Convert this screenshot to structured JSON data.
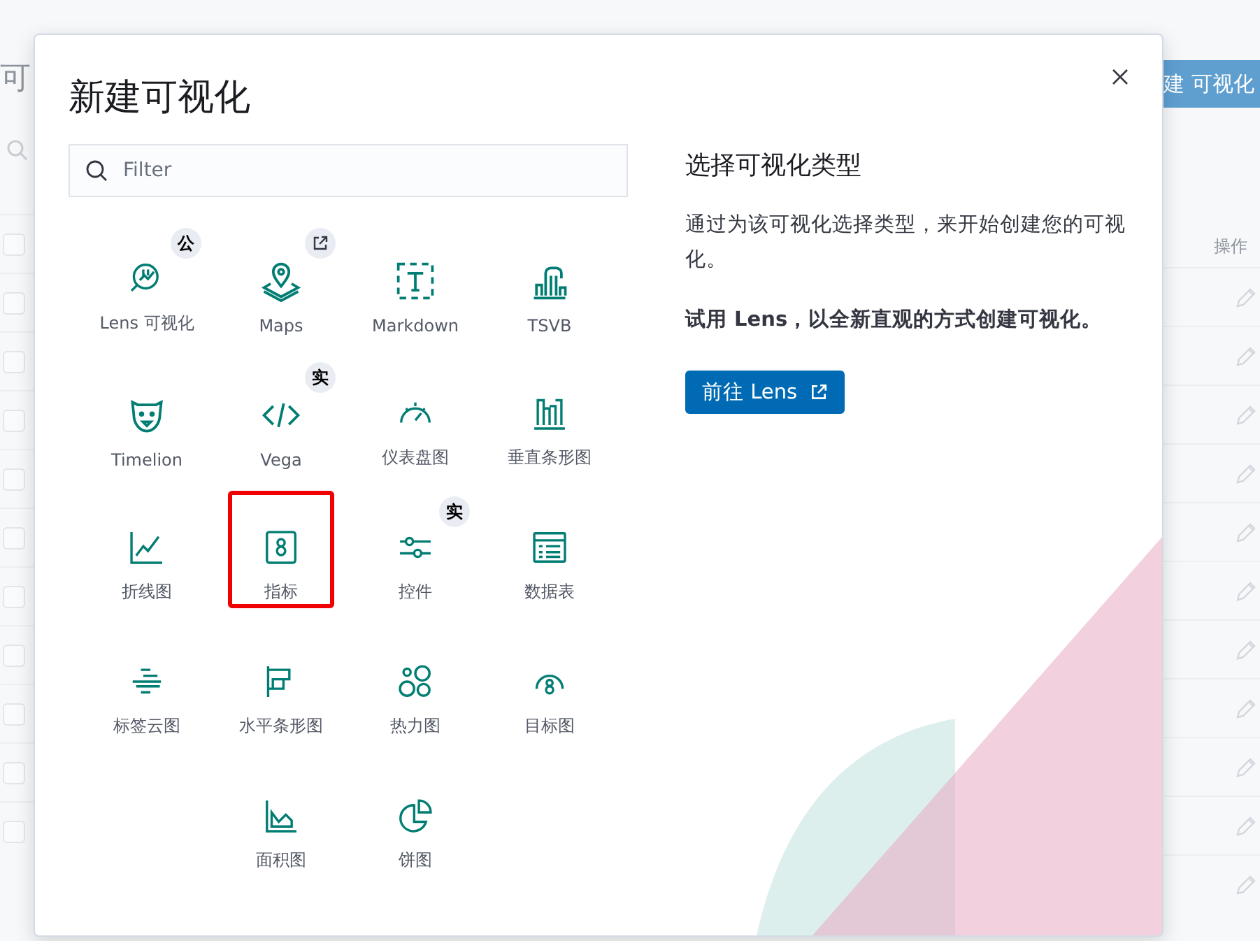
{
  "background_page": {
    "title": "可",
    "create_button": "建 可视化",
    "column_header": "操作",
    "rows": [
      {
        "checked": false
      },
      {
        "checked": false
      },
      {
        "checked": false
      },
      {
        "checked": false
      },
      {
        "checked": false
      },
      {
        "checked": false
      },
      {
        "checked": false
      },
      {
        "checked": false
      },
      {
        "checked": false
      },
      {
        "checked": false
      },
      {
        "checked": false
      }
    ]
  },
  "modal": {
    "title": "新建可视化",
    "search": {
      "placeholder": "Filter"
    },
    "type_rows": [
      [
        {
          "kind": "lens",
          "label": "Lens 可视化",
          "badge": {
            "kind": "text",
            "text": "公"
          },
          "highlighted": false
        },
        {
          "kind": "maps",
          "label": "Maps",
          "badge": {
            "kind": "external"
          },
          "highlighted": false
        },
        {
          "kind": "markdown",
          "label": "Markdown",
          "highlighted": false
        },
        {
          "kind": "tsvb",
          "label": "TSVB",
          "highlighted": false
        }
      ],
      [
        {
          "kind": "timelion",
          "label": "Timelion",
          "highlighted": false
        },
        {
          "kind": "vega",
          "label": "Vega",
          "badge": {
            "kind": "text",
            "text": "实"
          },
          "highlighted": false
        },
        {
          "kind": "gauge",
          "label": "仪表盘图",
          "highlighted": false
        },
        {
          "kind": "vbar",
          "label": "垂直条形图",
          "highlighted": false
        }
      ],
      [
        {
          "kind": "line",
          "label": "折线图",
          "highlighted": false
        },
        {
          "kind": "metric",
          "label": "指标",
          "highlighted": true
        },
        {
          "kind": "controls",
          "label": "控件",
          "badge": {
            "kind": "text",
            "text": "实"
          },
          "highlighted": false
        },
        {
          "kind": "table",
          "label": "数据表",
          "highlighted": false
        }
      ],
      [
        {
          "kind": "tagcloud",
          "label": "标签云图",
          "highlighted": false
        },
        {
          "kind": "hbar",
          "label": "水平条形图",
          "highlighted": false
        },
        {
          "kind": "heatmap",
          "label": "热力图",
          "highlighted": false
        },
        {
          "kind": "goal",
          "label": "目标图",
          "highlighted": false
        }
      ],
      [
        {
          "kind": "area",
          "label": "面积图",
          "highlighted": false
        },
        {
          "kind": "pie",
          "label": "饼图",
          "highlighted": false
        }
      ]
    ],
    "side": {
      "heading": "选择可视化类型",
      "description": "通过为该可视化选择类型，来开始创建您的可视化。",
      "hint": "试用 Lens，以全新直观的方式创建可视化。",
      "button": "前往 Lens"
    }
  }
}
